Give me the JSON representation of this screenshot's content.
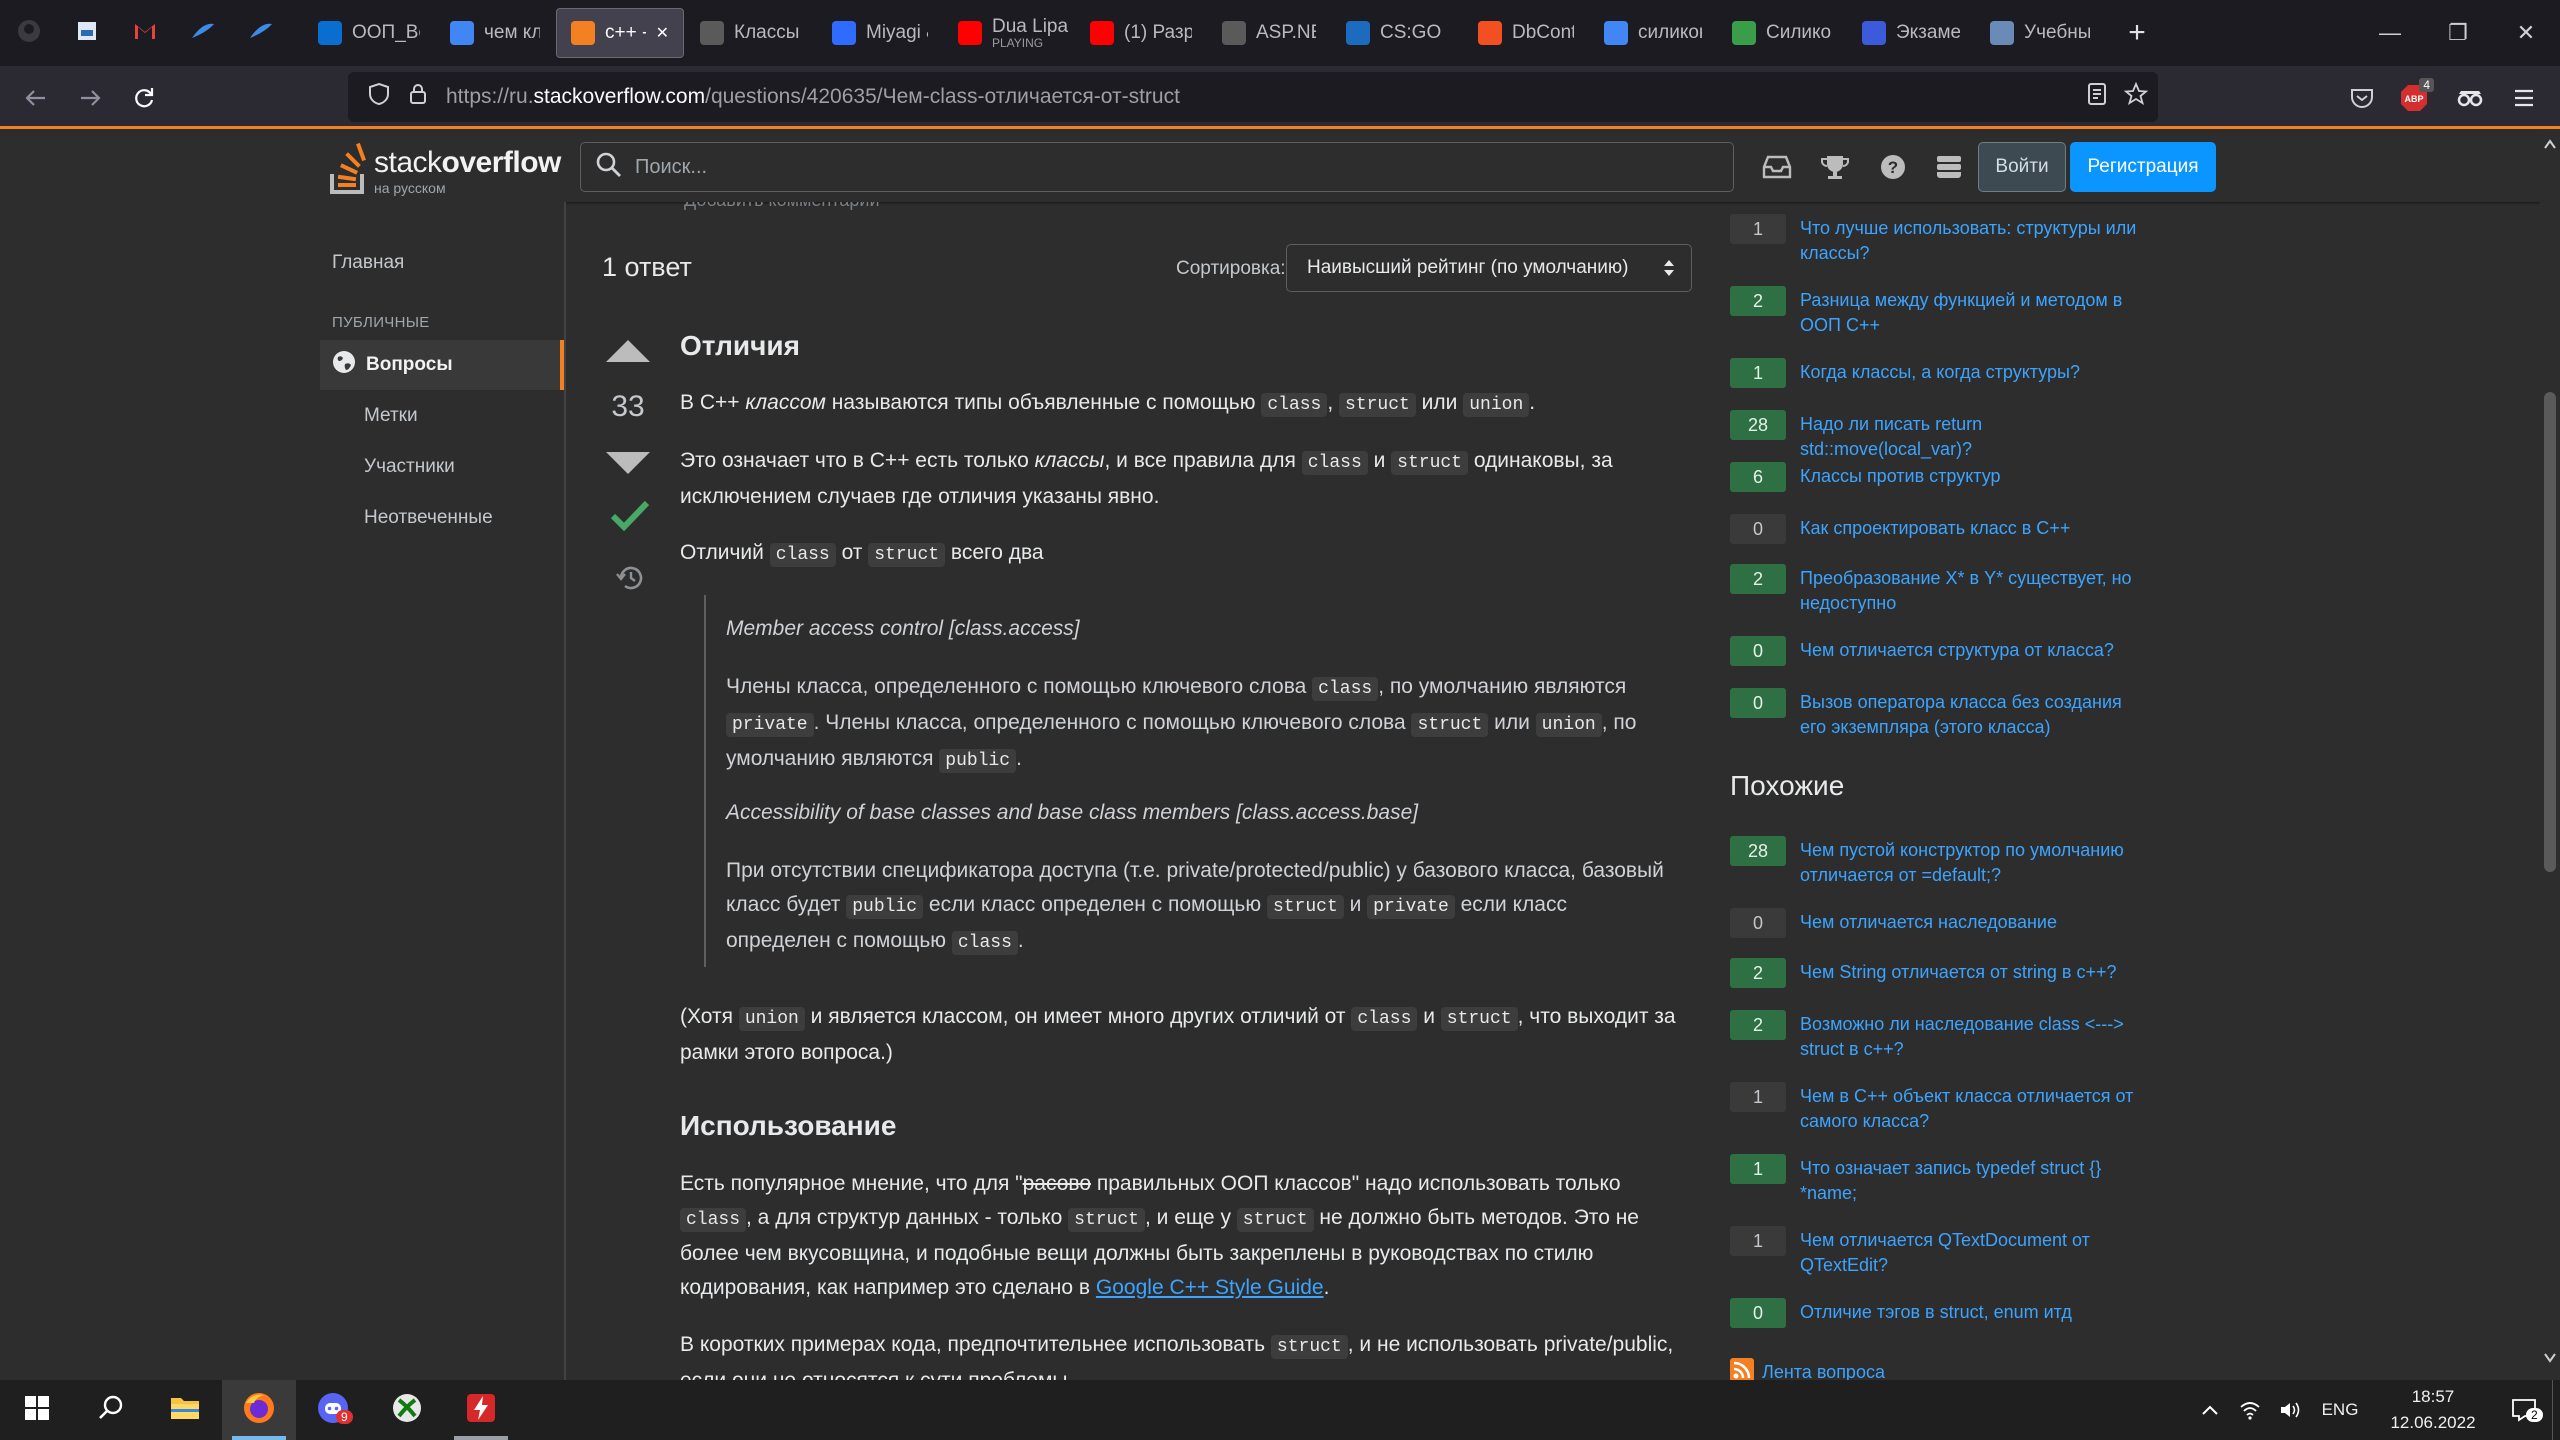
{
  "browser": {
    "tabs": [
      {
        "label": "ООП_Во",
        "icon": "oop-icon",
        "color": "#0a6ed1"
      },
      {
        "label": "чем клас",
        "icon": "google-icon",
        "color": "#4285f4"
      },
      {
        "label": "c++ -",
        "icon": "stackoverflow-icon",
        "color": "#f48024",
        "active": true
      },
      {
        "label": "Классы и",
        "icon": "c-sharp-icon",
        "color": "#5a5a5a"
      },
      {
        "label": "Miyagi &",
        "icon": "music-icon",
        "color": "#2f6bff"
      },
      {
        "label": "Dua Lipa",
        "sublabel": "PLAYING",
        "icon": "youtube-icon",
        "color": "#ff0000"
      },
      {
        "label": "(1) Разра",
        "icon": "youtube-icon",
        "color": "#ff0000"
      },
      {
        "label": "ASP.NET",
        "icon": "mail-icon",
        "color": "#5a5a5a"
      },
      {
        "label": "CS:GO M",
        "icon": "csgo-icon",
        "color": "#1c6bbf"
      },
      {
        "label": "DbConte",
        "icon": "microsoft-icon",
        "color": "#f25022"
      },
      {
        "label": "силикон",
        "icon": "google-icon",
        "color": "#4285f4"
      },
      {
        "label": "Силикон",
        "icon": "hd-icon",
        "color": "#3a9d4a"
      },
      {
        "label": "Экзамен",
        "icon": "exam-icon",
        "color": "#3b5bdb"
      },
      {
        "label": "Учебный",
        "icon": "doc-icon",
        "color": "#6a8bb8"
      }
    ],
    "url_prefix": "https://ru.",
    "url_domain": "stackoverflow.com",
    "url_path": "/questions/420635/Чем-class-отличается-от-struct",
    "adblock_badge": "4"
  },
  "site": {
    "logo_word_light": "stack",
    "logo_word_bold": "overflow",
    "logo_sub": "на русском",
    "search_placeholder": "Поиск...",
    "login": "Войти",
    "signup": "Регистрация"
  },
  "leftnav": {
    "home": "Главная",
    "group": "ПУБЛИЧНЫЕ",
    "questions": "Вопросы",
    "tags": "Метки",
    "users": "Участники",
    "unanswered": "Неотвеченные"
  },
  "main": {
    "add_comment": "Добавить комментарий",
    "answers_count": "1 ответ",
    "sort_label": "Сортировка:",
    "sort_value": "Наивысший рейтинг (по умолчанию)",
    "score": "33",
    "h_diff": "Отличия",
    "p1": {
      "a": "В C++ ",
      "b": "классом",
      "c": " называются типы объявленные с помощью ",
      "k1": "class",
      "d": ", ",
      "k2": "struct",
      "e": " или ",
      "k3": "union",
      "f": "."
    },
    "p2": {
      "a": "Это означает что в C++ есть только ",
      "b": "классы",
      "c": ", и все правила для ",
      "k1": "class",
      "d": " и ",
      "k2": "struct",
      "e": " одинаковы, за исключением случаев где отличия указаны явно."
    },
    "p3": {
      "a": "Отличий ",
      "k1": "class",
      "b": " от ",
      "k2": "struct",
      "c": " всего два"
    },
    "q1": "Member access control [class.access]",
    "q2": {
      "a": "Члены класса, определенного с помощью ключевого слова ",
      "k1": "class",
      "b": ", по умолчанию являются ",
      "k2": "private",
      "c": ". Члены класса, определенного с помощью ключевого слова ",
      "k3": "struct",
      "d": " или ",
      "k4": "union",
      "e": ", по умолчанию являются ",
      "k5": "public",
      "f": "."
    },
    "q3": "Accessibility of base classes and base class members [class.access.base]",
    "q4": {
      "a": "При отсутствии спецификатора доступа (т.е. private/protected/public) у базового класса, базовый класс будет ",
      "k1": "public",
      "b": " если класс определен с помощью ",
      "k2": "struct",
      "c": " и ",
      "k3": "private",
      "d": " если класс определен с помощью ",
      "k4": "class",
      "e": "."
    },
    "p4": {
      "a": "(Хотя ",
      "k1": "union",
      "b": " и является классом, он имеет много других отличий от ",
      "k2": "class",
      "c": " и ",
      "k3": "struct",
      "d": ", что выходит за рамки этого вопроса.)"
    },
    "h_usage": "Использование",
    "p5": {
      "a": "Есть популярное мнение, что для \"",
      "s": "расово",
      "b": " правильных ООП классов\" надо использовать только ",
      "k1": "class",
      "c": ", а для структур данных - только ",
      "k2": "struct",
      "d": ", и еще у ",
      "k3": "struct",
      "e": " не должно быть методов. Это не более чем вкусовщина, и подобные вещи должны быть закреплены в руководствах по стилю кодирования, как например это сделано в ",
      "link": "Google C++ Style Guide",
      "f": "."
    },
    "p6": {
      "a": "В коротких примерах кода, предпочтительнее использовать ",
      "k1": "struct",
      "b": ", и не использовать private/public, если они не относятся к сути проблемы."
    }
  },
  "right": {
    "linked": [
      {
        "votes": "1",
        "answered": false,
        "title": "Что лучше использовать: структуры или классы?"
      },
      {
        "votes": "2",
        "answered": true,
        "title": "Разница между функцией и методом в ООП C++"
      },
      {
        "votes": "1",
        "answered": true,
        "title": "Когда классы, а когда структуры?"
      },
      {
        "votes": "28",
        "answered": true,
        "title": "Надо ли писать return std::move(local_var)?"
      },
      {
        "votes": "6",
        "answered": true,
        "title": "Классы против структур"
      },
      {
        "votes": "0",
        "answered": false,
        "title": "Как спроектировать класс в C++"
      },
      {
        "votes": "2",
        "answered": true,
        "title": "Преобразование X* в Y* существует, но недоступно"
      },
      {
        "votes": "0",
        "answered": true,
        "title": "Чем отличается структура от класса?"
      },
      {
        "votes": "0",
        "answered": true,
        "title": "Вызов оператора класса без создания его экземпляра (этого класса)"
      }
    ],
    "related_heading": "Похожие",
    "related": [
      {
        "votes": "28",
        "answered": true,
        "title": "Чем пустой конструктор по умолчанию отличается от =default;?"
      },
      {
        "votes": "0",
        "answered": false,
        "title": "Чем отличается наследование"
      },
      {
        "votes": "2",
        "answered": true,
        "title": "Чем String отличается от string в c++?"
      },
      {
        "votes": "2",
        "answered": true,
        "title": "Возможно ли наследование class <---> struct в c++?"
      },
      {
        "votes": "1",
        "answered": false,
        "title": "Чем в C++ объект класса отличается от самого класса?"
      },
      {
        "votes": "1",
        "answered": true,
        "title": "Что означает запись typedef struct {} *name;"
      },
      {
        "votes": "1",
        "answered": false,
        "title": "Чем отличается QTextDocument от QTextEdit?"
      },
      {
        "votes": "0",
        "answered": true,
        "title": "Отличие тэгов в struct, enum итд"
      }
    ],
    "feed": "Лента вопроса"
  },
  "taskbar": {
    "lang": "ENG",
    "time": "18:57",
    "date": "12.06.2022",
    "discord_badge": "9",
    "notif_badge": "2"
  },
  "colors": {
    "accent": "#f48024",
    "link": "#3ca4ff",
    "accepted": "#2f6f44",
    "primary_button": "#0a95ff"
  }
}
